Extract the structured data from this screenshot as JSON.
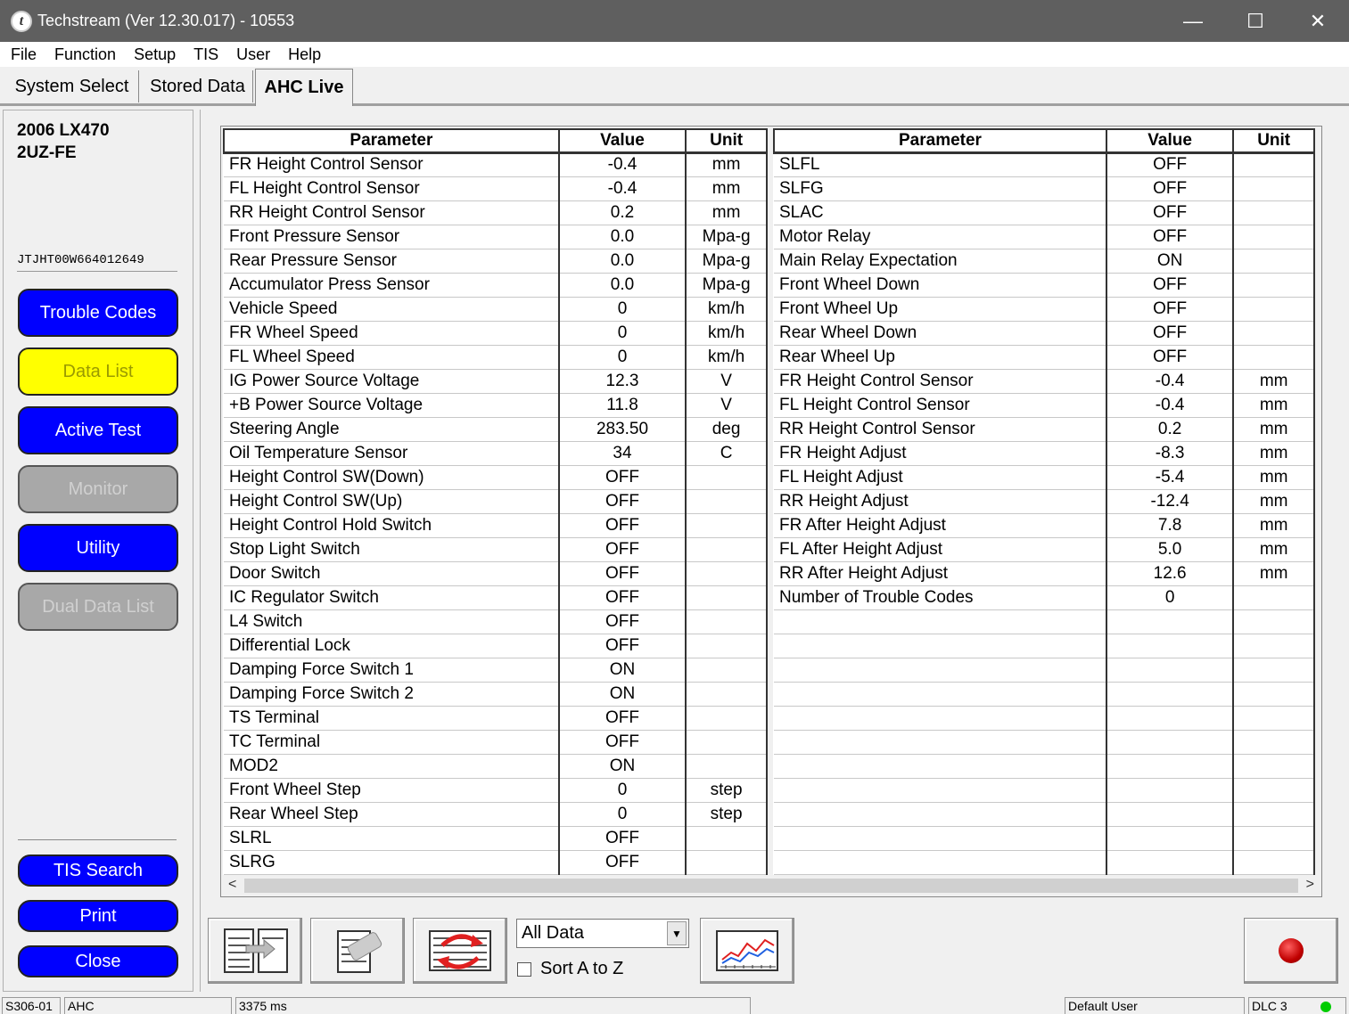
{
  "window": {
    "title": "Techstream (Ver 12.30.017) - 10553",
    "minimize": "—",
    "maximize": "☐",
    "close": "✕"
  },
  "menu": [
    "File",
    "Function",
    "Setup",
    "TIS",
    "User",
    "Help"
  ],
  "tabs": [
    "System Select",
    "Stored Data",
    "AHC Live"
  ],
  "vehicle": {
    "model": "2006 LX470",
    "engine": "2UZ-FE",
    "vin": "JTJHT00W664012649"
  },
  "nav": {
    "trouble_codes": "Trouble Codes",
    "data_list": "Data List",
    "active_test": "Active Test",
    "monitor": "Monitor",
    "utility": "Utility",
    "dual_data_list": "Dual Data List",
    "tis_search": "TIS Search",
    "print": "Print",
    "close": "Close"
  },
  "table_headers": {
    "parameter": "Parameter",
    "value": "Value",
    "unit": "Unit"
  },
  "left_rows": [
    [
      "FR Height Control Sensor",
      "-0.4",
      "mm"
    ],
    [
      "FL Height Control Sensor",
      "-0.4",
      "mm"
    ],
    [
      "RR Height Control Sensor",
      "0.2",
      "mm"
    ],
    [
      "Front Pressure Sensor",
      "0.0",
      "Mpa-g"
    ],
    [
      "Rear Pressure Sensor",
      "0.0",
      "Mpa-g"
    ],
    [
      "Accumulator Press Sensor",
      "0.0",
      "Mpa-g"
    ],
    [
      "Vehicle Speed",
      "0",
      "km/h"
    ],
    [
      "FR Wheel Speed",
      "0",
      "km/h"
    ],
    [
      "FL Wheel Speed",
      "0",
      "km/h"
    ],
    [
      "IG Power Source Voltage",
      "12.3",
      "V"
    ],
    [
      "+B Power Source Voltage",
      "11.8",
      "V"
    ],
    [
      "Steering Angle",
      "283.50",
      "deg"
    ],
    [
      "Oil Temperature Sensor",
      "34",
      "C"
    ],
    [
      "Height Control SW(Down)",
      "OFF",
      ""
    ],
    [
      "Height Control SW(Up)",
      "OFF",
      ""
    ],
    [
      "Height Control Hold Switch",
      "OFF",
      ""
    ],
    [
      "Stop Light Switch",
      "OFF",
      ""
    ],
    [
      "Door Switch",
      "OFF",
      ""
    ],
    [
      "IC Regulator Switch",
      "OFF",
      ""
    ],
    [
      "L4 Switch",
      "OFF",
      ""
    ],
    [
      "Differential Lock",
      "OFF",
      ""
    ],
    [
      "Damping Force Switch 1",
      "ON",
      ""
    ],
    [
      "Damping Force Switch 2",
      "ON",
      ""
    ],
    [
      "TS Terminal",
      "OFF",
      ""
    ],
    [
      "TC Terminal",
      "OFF",
      ""
    ],
    [
      "MOD2",
      "ON",
      ""
    ],
    [
      "Front Wheel Step",
      "0",
      "step"
    ],
    [
      "Rear Wheel Step",
      "0",
      "step"
    ],
    [
      "SLRL",
      "OFF",
      ""
    ],
    [
      "SLRG",
      "OFF",
      ""
    ]
  ],
  "right_rows": [
    [
      "SLFL",
      "OFF",
      ""
    ],
    [
      "SLFG",
      "OFF",
      ""
    ],
    [
      "SLAC",
      "OFF",
      ""
    ],
    [
      "Motor Relay",
      "OFF",
      ""
    ],
    [
      "Main Relay Expectation",
      "ON",
      ""
    ],
    [
      "Front Wheel Down",
      "OFF",
      ""
    ],
    [
      "Front Wheel Up",
      "OFF",
      ""
    ],
    [
      "Rear Wheel Down",
      "OFF",
      ""
    ],
    [
      "Rear Wheel Up",
      "OFF",
      ""
    ],
    [
      "FR Height Control Sensor",
      "-0.4",
      "mm"
    ],
    [
      "FL Height Control Sensor",
      "-0.4",
      "mm"
    ],
    [
      "RR Height Control Sensor",
      "0.2",
      "mm"
    ],
    [
      "FR Height Adjust",
      "-8.3",
      "mm"
    ],
    [
      "FL Height Adjust",
      "-5.4",
      "mm"
    ],
    [
      "RR Height Adjust",
      "-12.4",
      "mm"
    ],
    [
      "FR After Height Adjust",
      "7.8",
      "mm"
    ],
    [
      "FL After Height Adjust",
      "5.0",
      "mm"
    ],
    [
      "RR After Height Adjust",
      "12.6",
      "mm"
    ],
    [
      "Number of Trouble Codes",
      "0",
      ""
    ],
    [
      "",
      "",
      ""
    ],
    [
      "",
      "",
      ""
    ],
    [
      "",
      "",
      ""
    ],
    [
      "",
      "",
      ""
    ],
    [
      "",
      "",
      ""
    ],
    [
      "",
      "",
      ""
    ],
    [
      "",
      "",
      ""
    ],
    [
      "",
      "",
      ""
    ],
    [
      "",
      "",
      ""
    ],
    [
      "",
      "",
      ""
    ],
    [
      "",
      "",
      ""
    ]
  ],
  "toolbar": {
    "filter_value": "All Data",
    "sort_label": "Sort A to Z"
  },
  "status": {
    "code": "S306-01",
    "system": "AHC",
    "interval": "3375 ms",
    "user": "Default User",
    "dlc": "DLC 3"
  },
  "colors": {
    "nav_blue": "#0000ff",
    "nav_yellow": "#ffff00",
    "nav_disabled": "#a8a8a8",
    "record": "#cc0000",
    "dlc_ok": "#00cc00"
  }
}
